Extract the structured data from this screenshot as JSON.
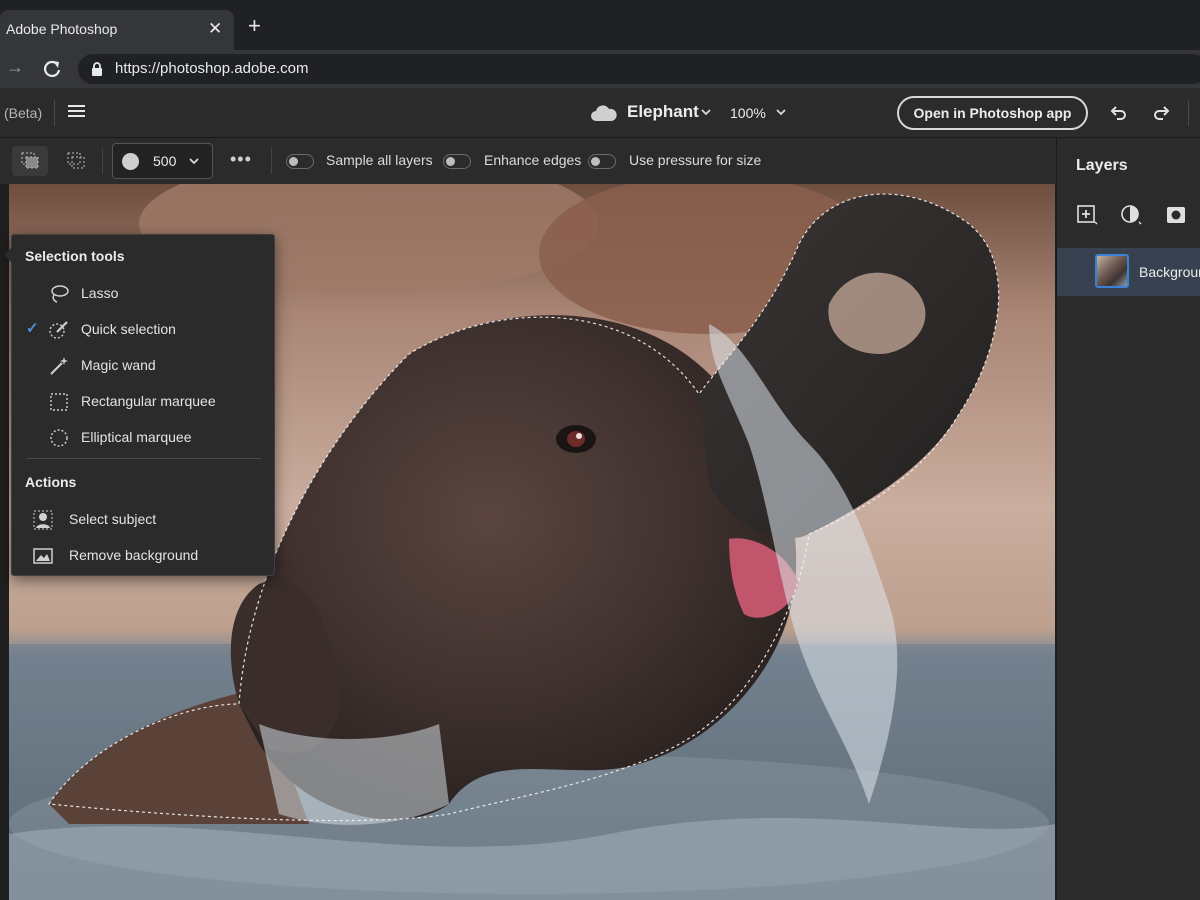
{
  "browser": {
    "tab_title": "Adobe Photoshop",
    "tab_close": "✕",
    "new_tab": "+",
    "url": "https://photoshop.adobe.com"
  },
  "appbar": {
    "beta": "(Beta)",
    "document_name": "Elephant",
    "zoom": "100%",
    "open_in_app": "Open in Photoshop app"
  },
  "options": {
    "brush_size": "500",
    "more": "•••",
    "sample_all_layers": "Sample all layers",
    "enhance_edges": "Enhance edges",
    "use_pressure": "Use pressure for size"
  },
  "flyout": {
    "section_title": "Selection tools",
    "tools": [
      {
        "label": "Lasso",
        "icon": "lasso-icon",
        "checked": false
      },
      {
        "label": "Quick selection",
        "icon": "quick-selection-icon",
        "checked": true
      },
      {
        "label": "Magic wand",
        "icon": "magic-wand-icon",
        "checked": false
      },
      {
        "label": "Rectangular marquee",
        "icon": "rectangular-marquee-icon",
        "checked": false
      },
      {
        "label": "Elliptical marquee",
        "icon": "elliptical-marquee-icon",
        "checked": false
      }
    ],
    "check_mark": "✓",
    "actions_title": "Actions",
    "actions": [
      {
        "label": "Select subject",
        "icon": "select-subject-icon"
      },
      {
        "label": "Remove background",
        "icon": "remove-background-icon"
      }
    ]
  },
  "layers": {
    "title": "Layers",
    "items": [
      {
        "name": "Background",
        "selected": true
      }
    ]
  },
  "colors": {
    "accent": "#3b82d6",
    "panel_bg": "#2b2b2b",
    "selected_row": "#38414f"
  }
}
